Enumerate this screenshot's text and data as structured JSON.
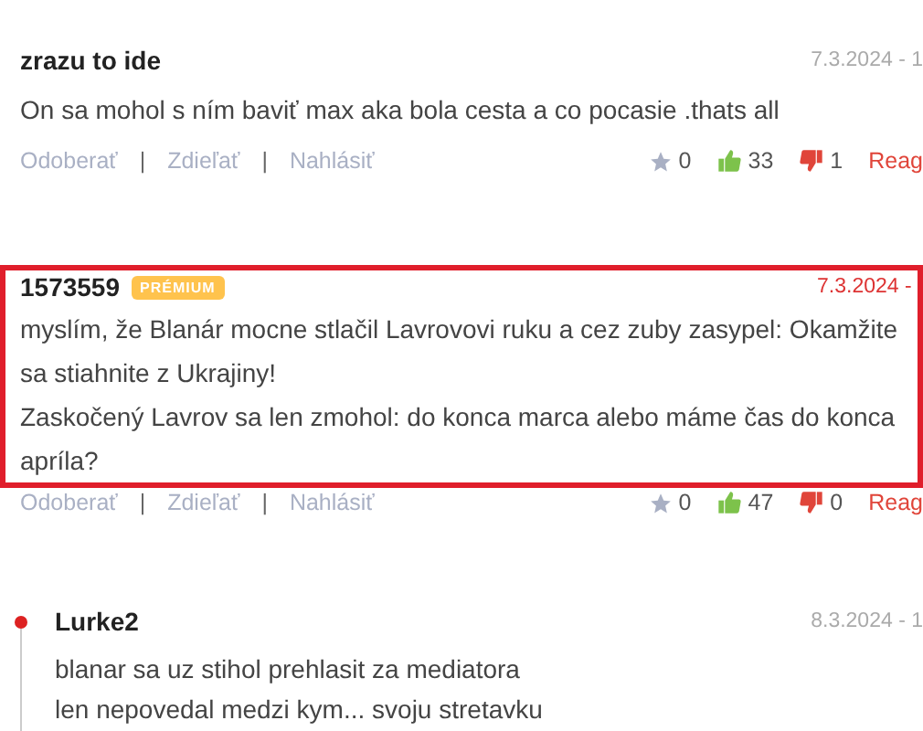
{
  "comments": [
    {
      "author": "zrazu to ide",
      "date": "7.3.2024 - 1",
      "highlighted": false,
      "reply": false,
      "paragraphs": [
        "On sa mohol s ním baviť max aka bola cesta a co pocasie .thats all"
      ],
      "actions": {
        "links": [
          "Odoberať",
          "Zdieľať",
          "Nahlásiť"
        ],
        "separators": [
          "|",
          "|"
        ],
        "favorites": "0",
        "likes": "33",
        "dislikes": "1",
        "react": "Reag"
      }
    },
    {
      "author": "1573559",
      "badge": "PRÉMIUM",
      "date": "7.3.2024 - ",
      "highlighted": true,
      "reply": false,
      "paragraphs": [
        "myslím, že Blanár mocne stlačil Lavrovovi ruku a cez zuby zasypel: Okamžite sa stiahnite z Ukrajiny!",
        "Zaskočený Lavrov sa len zmohol: do konca marca alebo máme čas do konca apríla?"
      ],
      "actions": {
        "links": [
          "Odoberať",
          "Zdieľať",
          "Nahlásiť"
        ],
        "separators": [
          "|",
          "|"
        ],
        "favorites": "0",
        "likes": "47",
        "dislikes": "0",
        "react": "Reag"
      }
    },
    {
      "author": "Lurke2",
      "date": "8.3.2024 - 1",
      "highlighted": false,
      "reply": true,
      "paragraphs": [
        "blanar sa uz stihol prehlasit za mediatora",
        "len nepovedal medzi kym... svoju stretavku"
      ]
    }
  ]
}
